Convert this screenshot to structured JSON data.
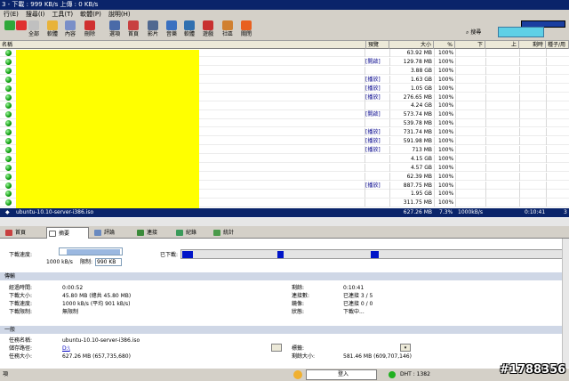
{
  "window": {
    "title": "3 - 下載 : 999 KB/s    上傳 : 0 KB/s"
  },
  "menu": [
    "行(E)",
    "搜尋(I)",
    "工具(T)",
    "軟體(P)",
    "說明(H)"
  ],
  "toolbar": [
    {
      "label": "",
      "icon": "play-icon",
      "color": "#2fa83a"
    },
    {
      "label": "",
      "icon": "stop-icon",
      "color": "#e03030"
    },
    {
      "label": "全部",
      "icon": "stop-all-icon",
      "color": "#c0c0c0"
    },
    {
      "label": "軟體",
      "icon": "folder-icon",
      "color": "#e8b33a"
    },
    {
      "label": "內容",
      "icon": "properties-icon",
      "color": "#7a8fc8"
    },
    {
      "label": "刪除",
      "icon": "delete-icon",
      "color": "#d03030"
    },
    {
      "label": "選項",
      "icon": "options-icon",
      "color": "#4a6aa8"
    },
    {
      "label": "首頁",
      "icon": "home-icon",
      "color": "#c84040"
    },
    {
      "label": "影片",
      "icon": "video-icon",
      "color": "#506890"
    },
    {
      "label": "音樂",
      "icon": "music-icon",
      "color": "#3a70c0"
    },
    {
      "label": "軟體",
      "icon": "software-icon",
      "color": "#3070b0"
    },
    {
      "label": "遊戲",
      "icon": "game-icon",
      "color": "#c83030"
    },
    {
      "label": "社區",
      "icon": "community-icon",
      "color": "#d08030"
    },
    {
      "label": "關閉",
      "icon": "close-icon",
      "color": "#e86020"
    }
  ],
  "search": {
    "label": "搜尋"
  },
  "columns": [
    "名稱",
    "預覽",
    "大小",
    "%",
    "下",
    "上",
    "剩時",
    "種子/用"
  ],
  "rows": [
    {
      "action": "",
      "size": "63.92 MB",
      "pct": "100%"
    },
    {
      "action": "[開啟]",
      "size": "129.78 MB",
      "pct": "100%"
    },
    {
      "action": "",
      "size": "3.88 GB",
      "pct": "100%"
    },
    {
      "action": "[播放]",
      "size": "1.63 GB",
      "pct": "100%"
    },
    {
      "action": "[播放]",
      "size": "1.05 GB",
      "pct": "100%"
    },
    {
      "action": "[播放]",
      "size": "276.65 MB",
      "pct": "100%"
    },
    {
      "action": "",
      "size": "4.24 GB",
      "pct": "100%"
    },
    {
      "action": "[開啟]",
      "size": "573.74 MB",
      "pct": "100%"
    },
    {
      "action": "",
      "size": "539.78 MB",
      "pct": "100%"
    },
    {
      "action": "[播放]",
      "size": "731.74 MB",
      "pct": "100%"
    },
    {
      "action": "[播放]",
      "size": "591.98 MB",
      "pct": "100%"
    },
    {
      "action": "[播放]",
      "size": "713 MB",
      "pct": "100%"
    },
    {
      "action": "",
      "size": "4.15 GB",
      "pct": "100%"
    },
    {
      "action": "",
      "size": "4.57 GB",
      "pct": "100%"
    },
    {
      "action": "",
      "size": "62.39 MB",
      "pct": "100%"
    },
    {
      "action": "[播放]",
      "size": "887.75 MB",
      "pct": "100%"
    },
    {
      "action": "",
      "size": "1.95 GB",
      "pct": "100%"
    },
    {
      "action": "",
      "size": "311.75 MB",
      "pct": "100%"
    }
  ],
  "selected": {
    "name": "ubuntu-10.10-server-i386.iso",
    "size": "627.26 MB",
    "pct": "7.3%",
    "down": "1000kB/s",
    "eta": "0:10:41",
    "seeds": "3"
  },
  "tabs": [
    "首頁",
    "摘要",
    "評論",
    "連接",
    "紀錄",
    "統計"
  ],
  "speed": {
    "label": "下載速度:",
    "left": "1000 kB/s",
    "limit_label": "限制:",
    "limit": "990 KB"
  },
  "downloaded_label": "已下載:",
  "progress": {
    "label": "傳輸"
  },
  "transfer": {
    "elapsed_label": "經過時間:",
    "elapsed": "0:00:52",
    "downloaded_label": "下載大小:",
    "downloaded": "45.80 MB (總共 45.80 MB)",
    "dlspeed_label": "下載速度:",
    "dlspeed": "1000 kB/s (平均 901 kB/s)",
    "limit_label": "下載限制:",
    "limit": "無限制",
    "remain_label": "剩餘:",
    "remain": "0:10:41",
    "conn_label": "連接數:",
    "conn": "已連接 3 / 5",
    "mirror_label": "鏡像:",
    "mirror": "已連接 0 / 0",
    "status_label": "狀態:",
    "status": "下載中..."
  },
  "general": {
    "header": "一般",
    "name_label": "任務名稱:",
    "name": "ubuntu-10.10-server-i386.iso",
    "path_label": "儲存路徑:",
    "path": "D:\\",
    "size_label": "任務大小:",
    "size": "627.26 MB (657,735,680)",
    "tag_label": "標籤:",
    "remaining_label": "剩餘大小:",
    "remaining": "581.46 MB (609,707,146)"
  },
  "statusbar": {
    "left": "項",
    "login": "登入",
    "dht": "DHT : 1382"
  },
  "watermark": "#1788356"
}
